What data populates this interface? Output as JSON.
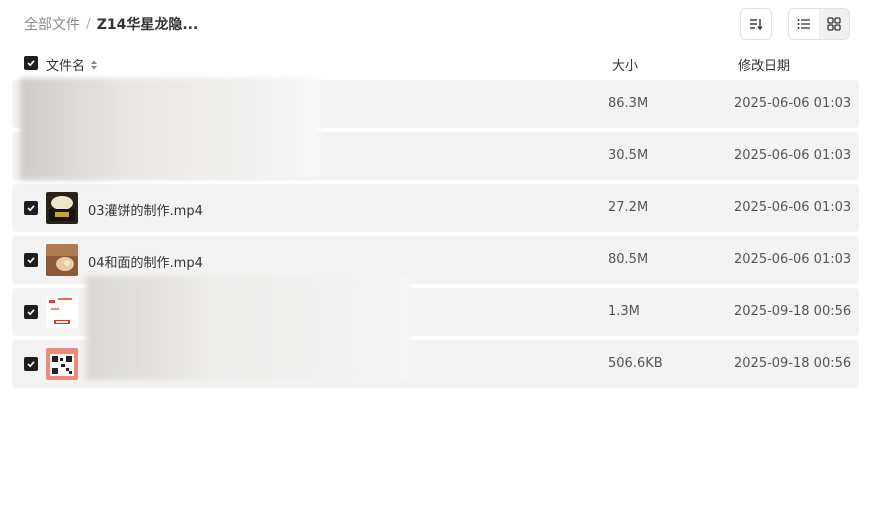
{
  "breadcrumb": {
    "root": "全部文件",
    "separator": "/",
    "current": "Z14华星龙隐..."
  },
  "toolbar": {
    "sort_icon": "sort-icon",
    "list_view_icon": "list-view-icon",
    "grid_view_icon": "grid-view-icon"
  },
  "columns": {
    "name": "文件名",
    "size": "大小",
    "date": "修改日期"
  },
  "files": [
    {
      "name": "",
      "size": "86.3M",
      "date": "2025-06-06 01:03",
      "thumb": "blurred"
    },
    {
      "name": "",
      "size": "30.5M",
      "date": "2025-06-06 01:03",
      "thumb": "blurred"
    },
    {
      "name": "03灌饼的制作.mp4",
      "size": "27.2M",
      "date": "2025-06-06 01:03",
      "thumb": "video"
    },
    {
      "name": "04和面的制作.mp4",
      "size": "80.5M",
      "date": "2025-06-06 01:03",
      "thumb": "video"
    },
    {
      "name": "",
      "size": "1.3M",
      "date": "2025-09-18 00:56",
      "thumb": "image"
    },
    {
      "name": "",
      "size": "506.6KB",
      "date": "2025-09-18 00:56",
      "thumb": "qr"
    }
  ],
  "colors": {
    "row_bg": "#f3f3f3",
    "checkbox": "#1e1e1e"
  }
}
